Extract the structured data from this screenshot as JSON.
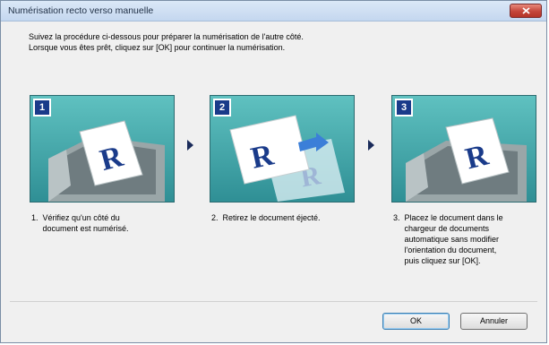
{
  "window": {
    "title": "Numérisation recto verso manuelle"
  },
  "instructions": {
    "line1": "Suivez la procédure ci-dessous pour préparer la numérisation de l'autre côté.",
    "line2": "Lorsque vous êtes prêt, cliquez sur [OK] pour continuer la numérisation."
  },
  "steps": [
    {
      "number": "1",
      "lines": [
        "1.  Vérifiez qu'un côté du",
        "     document est numérisé."
      ]
    },
    {
      "number": "2",
      "lines": [
        "2.  Retirez le document éjecté."
      ]
    },
    {
      "number": "3",
      "lines": [
        "3.  Placez le document dans le",
        "     chargeur de documents",
        "     automatique sans modifier",
        "     l'orientation du document,",
        "     puis cliquez sur [OK]."
      ]
    }
  ],
  "buttons": {
    "ok": "OK",
    "cancel": "Annuler"
  },
  "colors": {
    "panel_teal": "#3fa3a6",
    "badge_blue": "#1a3b8a",
    "close_red": "#c4453a"
  }
}
